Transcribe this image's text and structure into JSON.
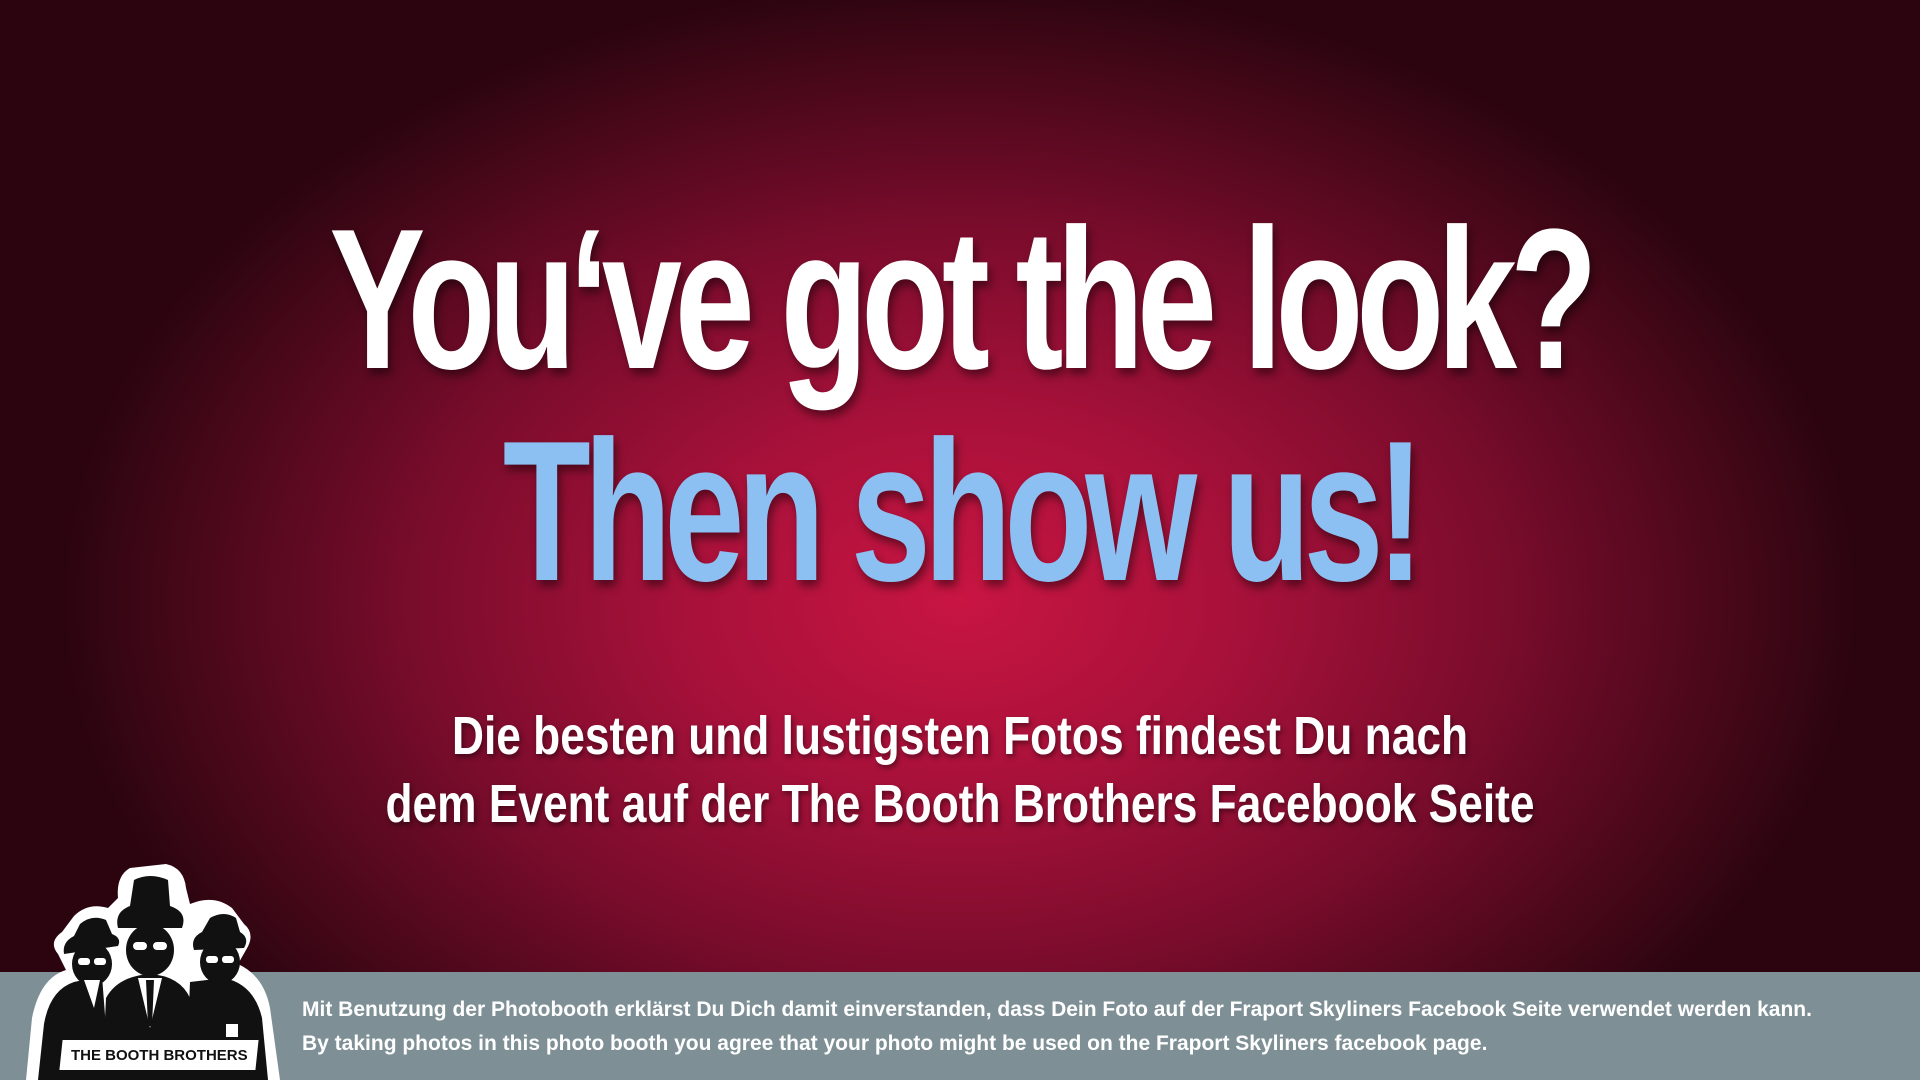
{
  "headline": {
    "line1": "You‘ve got the look?",
    "line2": "Then show us!"
  },
  "subline": {
    "line1": "Die besten und lustigsten Fotos findest Du nach",
    "line2": "dem Event auf der The Booth Brothers Facebook Seite"
  },
  "footer": {
    "consent_de": "Mit Benutzung der Photobooth erklärst Du Dich damit einverstanden, dass Dein Foto auf der Fraport Skyliners Facebook Seite verwendet werden kann.",
    "consent_en": "By taking photos in this photo booth you agree that your photo might be used on the Fraport Skyliners facebook page."
  },
  "logo": {
    "text": "THE BOOTH BROTHERS"
  },
  "colors": {
    "background": "#c81542",
    "headline_primary": "#ffffff",
    "headline_accent": "#8cc0f2",
    "footer_bar": "#7e9096"
  }
}
